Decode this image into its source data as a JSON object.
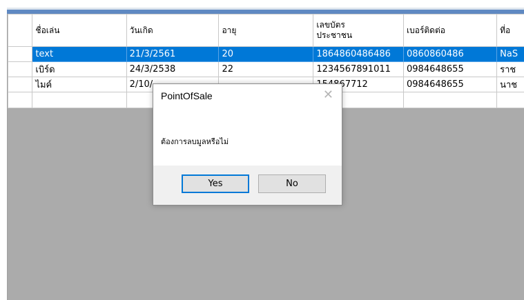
{
  "grid": {
    "columns": [
      "ชื่อเล่น",
      "วันเกิด",
      "อายุ",
      "เลขบัตร\nประชาชน",
      "เบอร์ติดต่อ",
      "ที่อ"
    ],
    "rows": [
      [
        "text",
        "21/3/2561",
        "20",
        "1864860486486",
        "0860860486",
        "NaS"
      ],
      [
        "เบิร์ด",
        "24/3/2538",
        "22",
        "1234567891011",
        "0984648655",
        "ราช"
      ],
      [
        "ไมค์",
        "2/10/",
        "",
        "154867712",
        "0984648655",
        "นาช"
      ]
    ]
  },
  "dialog": {
    "title": "PointOfSale",
    "close_glyph": "✕",
    "message": "ต้องการลบมูลหรือไม่",
    "yes_label": "Yes",
    "no_label": "No"
  }
}
